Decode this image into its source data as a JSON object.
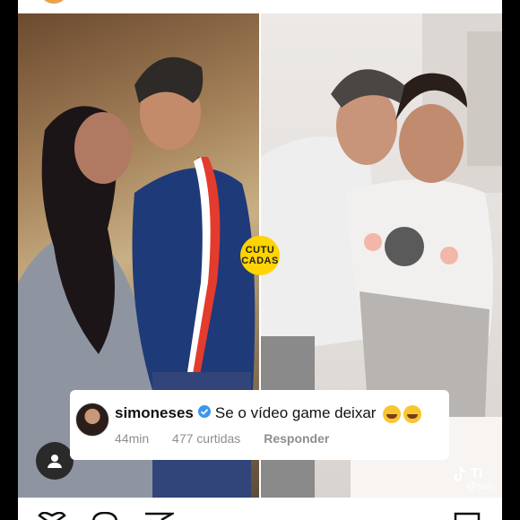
{
  "post": {
    "badge_line1": "CUTU",
    "badge_line2": "CADAS"
  },
  "comment": {
    "username": "simoneses",
    "text": "Se o vídeo game deixar",
    "time": "44min",
    "likes": "477 curtidas",
    "reply_label": "Responder"
  },
  "watermark": {
    "brand": "Ti",
    "handle": "@sim"
  },
  "colors": {
    "badge": "#ffd400",
    "verified": "#3897f0"
  },
  "icons": [
    "user-icon",
    "verified-icon",
    "laughing-emoji-icon",
    "tiktok-logo-icon",
    "heart-icon",
    "comment-icon",
    "share-icon",
    "bookmark-icon"
  ]
}
